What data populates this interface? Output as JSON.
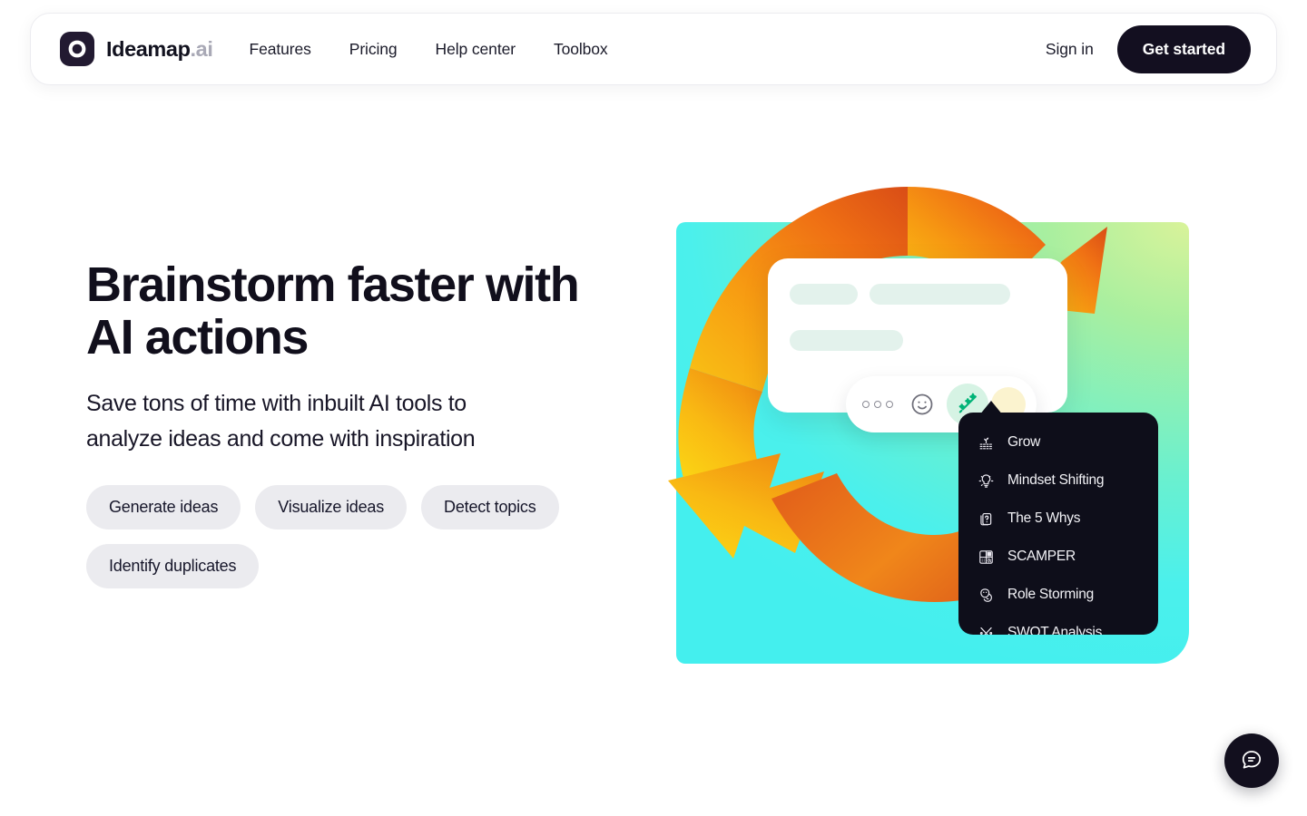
{
  "brand": {
    "name": "Ideamap",
    "tld": ".ai",
    "logo_icon": "ideamap-ring-logo-icon"
  },
  "nav": {
    "items": [
      {
        "label": "Features"
      },
      {
        "label": "Pricing"
      },
      {
        "label": "Help center"
      },
      {
        "label": "Toolbox"
      }
    ],
    "sign_in_label": "Sign in",
    "get_started_label": "Get started"
  },
  "hero": {
    "title": "Brainstorm faster with\nAI actions",
    "subtitle": "Save tons of time with inbuilt AI tools to\nanalyze ideas and come with inspiration",
    "pills": [
      {
        "label": "Generate ideas"
      },
      {
        "label": "Visualize ideas"
      },
      {
        "label": "Detect topics"
      },
      {
        "label": "Identify duplicates"
      }
    ]
  },
  "illustration": {
    "note_card": {
      "skeleton_lines": 3
    },
    "toolbar": {
      "buttons": [
        {
          "icon": "more-options-icon",
          "active": false
        },
        {
          "icon": "emoji-smiley-icon",
          "active": false
        },
        {
          "icon": "magic-wand-icon",
          "active": true
        },
        {
          "icon": "color-swatch-icon",
          "active": false
        }
      ]
    },
    "ai_menu": {
      "items": [
        {
          "icon": "sprout-grow-icon",
          "label": "Grow"
        },
        {
          "icon": "lightbulb-idea-icon",
          "label": "Mindset Shifting"
        },
        {
          "icon": "question-cards-icon",
          "label": "The 5 Whys"
        },
        {
          "icon": "grid-blocks-icon",
          "label": "SCAMPER"
        },
        {
          "icon": "theater-masks-icon",
          "label": "Role Storming"
        },
        {
          "icon": "swot-scissors-icon",
          "label": "SWOT Analysis"
        }
      ]
    }
  },
  "chat": {
    "icon": "chat-bubble-icon"
  },
  "colors": {
    "brand_dark": "#130f20",
    "page_background": "#ffffff",
    "pill_background": "#ebebef",
    "accent_green": "#00b377",
    "menu_background": "#0e0e1a",
    "gradient_start": "#d9f39a",
    "gradient_end": "#44efee"
  }
}
